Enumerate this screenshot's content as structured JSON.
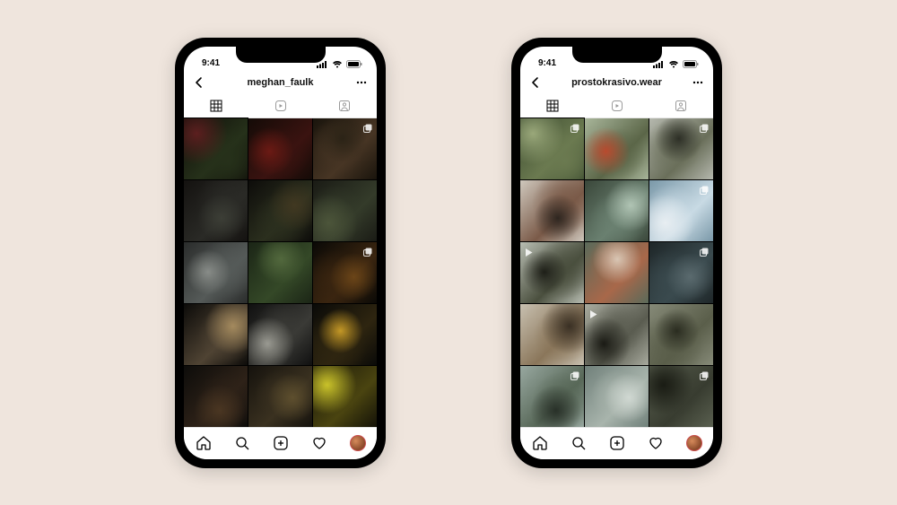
{
  "status": {
    "time": "9:41"
  },
  "phones": [
    {
      "username": "meghan_faulk",
      "palette": "dark",
      "cells": [
        {
          "colors": [
            "#0e0c08",
            "#26311a",
            "#5c1f1f"
          ],
          "badge": null
        },
        {
          "colors": [
            "#140b07",
            "#3a1310",
            "#6b1a14"
          ],
          "badge": null
        },
        {
          "colors": [
            "#19140c",
            "#473524",
            "#2b2316"
          ],
          "badge": "carousel"
        },
        {
          "colors": [
            "#141210",
            "#2a2a26",
            "#3c3e36"
          ],
          "badge": null
        },
        {
          "colors": [
            "#0d0c0a",
            "#2b2f1e",
            "#413821"
          ],
          "badge": null
        },
        {
          "colors": [
            "#1a1b15",
            "#343b2a",
            "#4c553a"
          ],
          "badge": null
        },
        {
          "colors": [
            "#2a2c2b",
            "#555a58",
            "#888c88"
          ],
          "badge": null
        },
        {
          "colors": [
            "#1b2516",
            "#344827",
            "#52683d"
          ],
          "badge": null
        },
        {
          "colors": [
            "#0a0906",
            "#3a2510",
            "#6b4518"
          ],
          "badge": "carousel"
        },
        {
          "colors": [
            "#0c0b09",
            "#4f4333",
            "#a48a5e"
          ],
          "badge": null
        },
        {
          "colors": [
            "#101010",
            "#3a3a36",
            "#9a9a92"
          ],
          "badge": null
        },
        {
          "colors": [
            "#0a0a08",
            "#2e2510",
            "#c49826"
          ],
          "badge": null
        },
        {
          "colors": [
            "#0d0c0a",
            "#2e2218",
            "#4a3622"
          ],
          "badge": null
        },
        {
          "colors": [
            "#15120d",
            "#3a3120",
            "#5e4f2e"
          ],
          "badge": null
        },
        {
          "colors": [
            "#141208",
            "#4a4410",
            "#c9c22a"
          ],
          "badge": null
        }
      ]
    },
    {
      "username": "prostokrasivo.wear",
      "palette": "muted",
      "cells": [
        {
          "colors": [
            "#3b4a2f",
            "#6b7a50",
            "#9aa87a"
          ],
          "badge": "carousel"
        },
        {
          "colors": [
            "#a8b59a",
            "#5b6648",
            "#b84a2e"
          ],
          "badge": null
        },
        {
          "colors": [
            "#b5b8ae",
            "#6a6f5a",
            "#2d2f26"
          ],
          "badge": "carousel"
        },
        {
          "colors": [
            "#cfc8bd",
            "#7a5a48",
            "#2e2620"
          ],
          "badge": null
        },
        {
          "colors": [
            "#3a473a",
            "#6a8070",
            "#b0c4b4"
          ],
          "badge": null
        },
        {
          "colors": [
            "#7a98a8",
            "#c8dae4",
            "#e8eef2"
          ],
          "badge": "carousel"
        },
        {
          "colors": [
            "#b8bdb2",
            "#4a4f3e",
            "#1e1f18"
          ],
          "badge": "play",
          "badge_pos": "tl"
        },
        {
          "colors": [
            "#5a6a5a",
            "#a8684a",
            "#d8c6b4"
          ],
          "badge": null
        },
        {
          "colors": [
            "#1e2628",
            "#3a4a4e",
            "#5a6a6e"
          ],
          "badge": "carousel"
        },
        {
          "colors": [
            "#c8c0b0",
            "#8a765a",
            "#3a3024"
          ],
          "badge": null
        },
        {
          "colors": [
            "#a8aa9e",
            "#5a5c50",
            "#1a1a14"
          ],
          "badge": "play",
          "badge_pos": "tl"
        },
        {
          "colors": [
            "#868a78",
            "#5a5e4a",
            "#2a2c20"
          ],
          "badge": null
        },
        {
          "colors": [
            "#98a8a0",
            "#586858",
            "#283028"
          ],
          "badge": "carousel"
        },
        {
          "colors": [
            "#70807a",
            "#a8b4ac",
            "#d0d8d2"
          ],
          "badge": null
        },
        {
          "colors": [
            "#5a6050",
            "#383c30",
            "#1a1c14"
          ],
          "badge": "carousel"
        }
      ]
    }
  ]
}
